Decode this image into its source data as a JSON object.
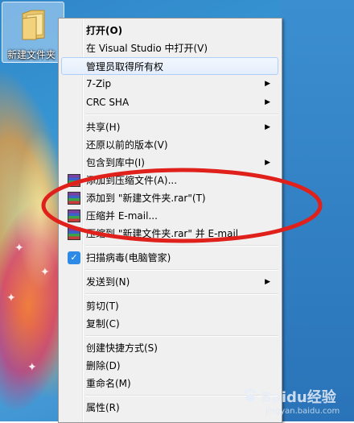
{
  "desktop": {
    "folder": {
      "label": "新建文件夹",
      "icon": "folder-icon"
    }
  },
  "context_menu": {
    "items": [
      {
        "label": "打开(O)",
        "bold": true
      },
      {
        "label": "在 Visual Studio 中打开(V)"
      },
      {
        "label": "管理员取得所有权",
        "hover": true
      },
      {
        "label": "7-Zip",
        "submenu": true
      },
      {
        "label": "CRC SHA",
        "submenu": true
      },
      {
        "label": "共享(H)",
        "submenu": true
      },
      {
        "label": "还原以前的版本(V)"
      },
      {
        "label": "包含到库中(I)",
        "submenu": true
      },
      {
        "label": "添加到压缩文件(A)...",
        "icon": "winrar-icon"
      },
      {
        "label": "添加到 \"新建文件夹.rar\"(T)",
        "icon": "winrar-icon"
      },
      {
        "label": "压缩并 E-mail...",
        "icon": "winrar-icon"
      },
      {
        "label": "压缩到 \"新建文件夹.rar\" 并 E-mail",
        "icon": "winrar-icon"
      },
      {
        "label": "扫描病毒(电脑管家)",
        "icon": "pc-manager-icon"
      },
      {
        "label": "发送到(N)",
        "submenu": true
      },
      {
        "label": "剪切(T)"
      },
      {
        "label": "复制(C)"
      },
      {
        "label": "创建快捷方式(S)"
      },
      {
        "label": "删除(D)"
      },
      {
        "label": "重命名(M)"
      },
      {
        "label": "属性(R)"
      }
    ]
  },
  "annotation": {
    "shape": "ellipse",
    "color": "#e0201b"
  },
  "watermark": {
    "text": "Baidu经验",
    "sub": "jingyan.baidu.com"
  },
  "colors": {
    "menu_bg": "#f0f0f0",
    "hover_border": "#aecff7",
    "desktop_blue": "#2f86c9"
  }
}
